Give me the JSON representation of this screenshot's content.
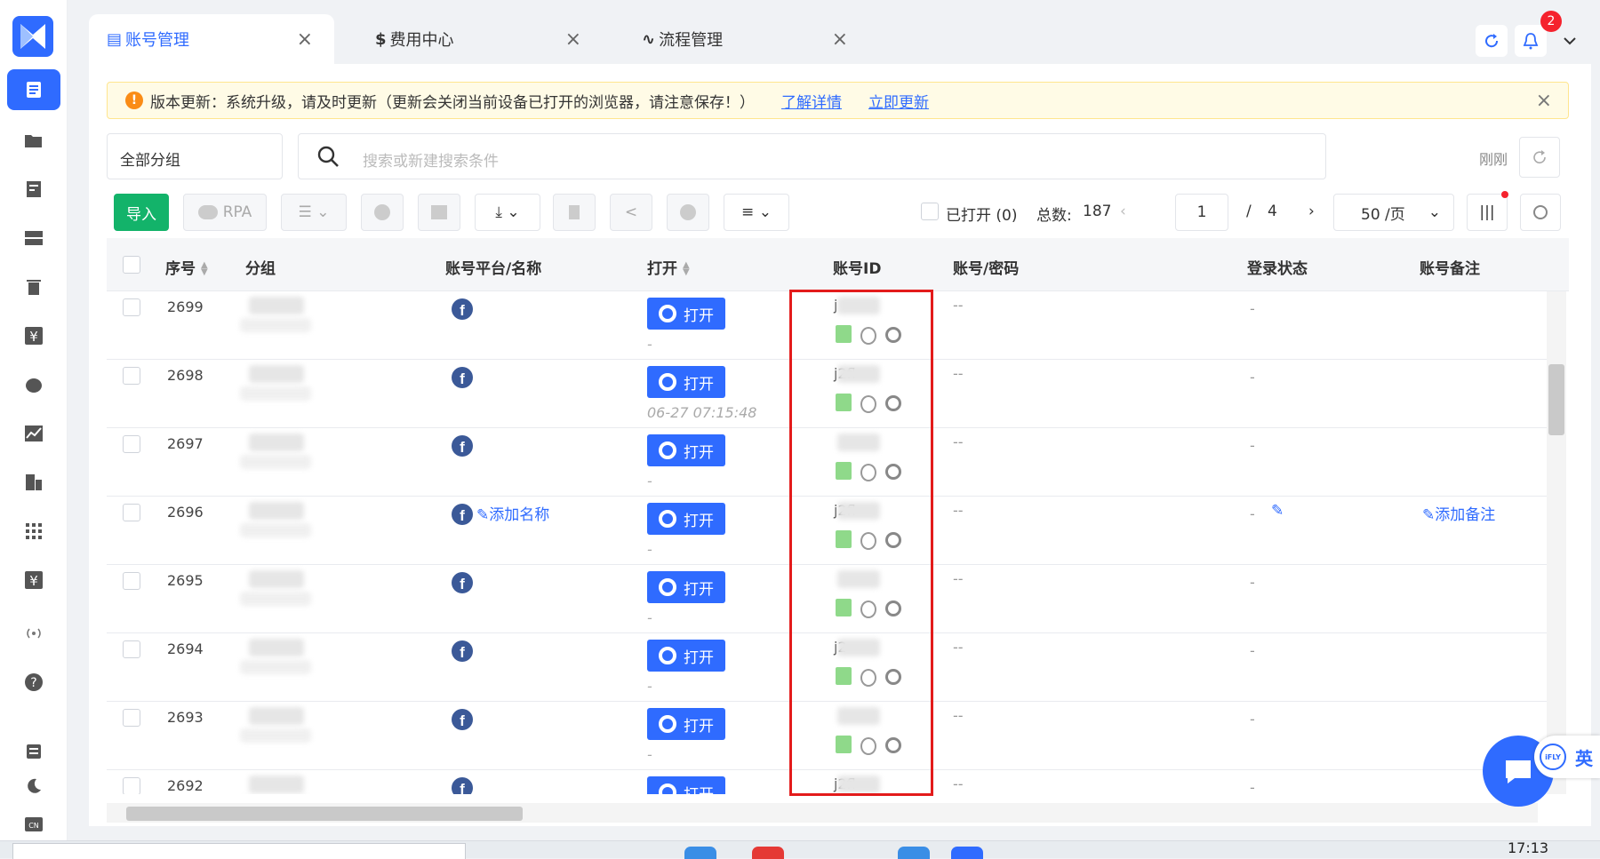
{
  "tabs": [
    {
      "label": "账号管理",
      "icon": "▤",
      "active": true
    },
    {
      "label": "费用中心",
      "icon": "$",
      "active": false
    },
    {
      "label": "流程管理",
      "icon": "∿",
      "active": false
    }
  ],
  "notifications_count": "2",
  "notice": {
    "text": "版本更新：系统升级，请及时更新（更新会关闭当前设备已打开的浏览器，请注意保存！）",
    "link_details": "了解详情",
    "link_update": "立即更新"
  },
  "filter": {
    "group_select": "全部分组",
    "search_placeholder": "搜索或新建搜索条件",
    "refreshed": "刚刚"
  },
  "toolbar": {
    "import_label": "导入",
    "rpa_label": "RPA",
    "opened_label": "已打开 (0)",
    "total_label": "总数:",
    "total_value": "187",
    "page_current": "1",
    "page_sep": "/",
    "page_total": "4",
    "page_size": "50 /页"
  },
  "table": {
    "headers": {
      "seq": "序号",
      "group": "分组",
      "platform": "账号平台/名称",
      "open": "打开",
      "account_id": "账号ID",
      "credentials": "账号/密码",
      "login_status": "登录状态",
      "remark": "账号备注"
    },
    "open_label": "打开",
    "add_name": "添加名称",
    "add_remark": "添加备注",
    "rows": [
      {
        "seq": "2699",
        "open_time": "-",
        "id_text": "j",
        "credentials": "--",
        "status": "-"
      },
      {
        "seq": "2698",
        "open_time": "06-27 07:15:48",
        "id_text": "j2fl",
        "credentials": "--",
        "status": "-"
      },
      {
        "seq": "2697",
        "open_time": "-",
        "id_text": "",
        "credentials": "--",
        "status": "-"
      },
      {
        "seq": "2696",
        "open_time": "-",
        "id_text": "j2fl",
        "credentials": "--",
        "status": "-"
      },
      {
        "seq": "2695",
        "open_time": "-",
        "id_text": "",
        "credentials": "--",
        "status": "-"
      },
      {
        "seq": "2694",
        "open_time": "-",
        "id_text": "j2",
        "credentials": "--",
        "status": "-"
      },
      {
        "seq": "2693",
        "open_time": "-",
        "id_text": "",
        "credentials": "--",
        "status": "-"
      },
      {
        "seq": "2692",
        "open_time": "",
        "id_text": "j2fl",
        "credentials": "--",
        "status": "-"
      }
    ]
  },
  "ifly_label": "英",
  "taskbar": {
    "clock": "17:13"
  },
  "colors": {
    "primary": "#2f6bff",
    "import_green": "#13b36a",
    "highlight_red": "#e31b1b",
    "facebook": "#3b5998"
  }
}
